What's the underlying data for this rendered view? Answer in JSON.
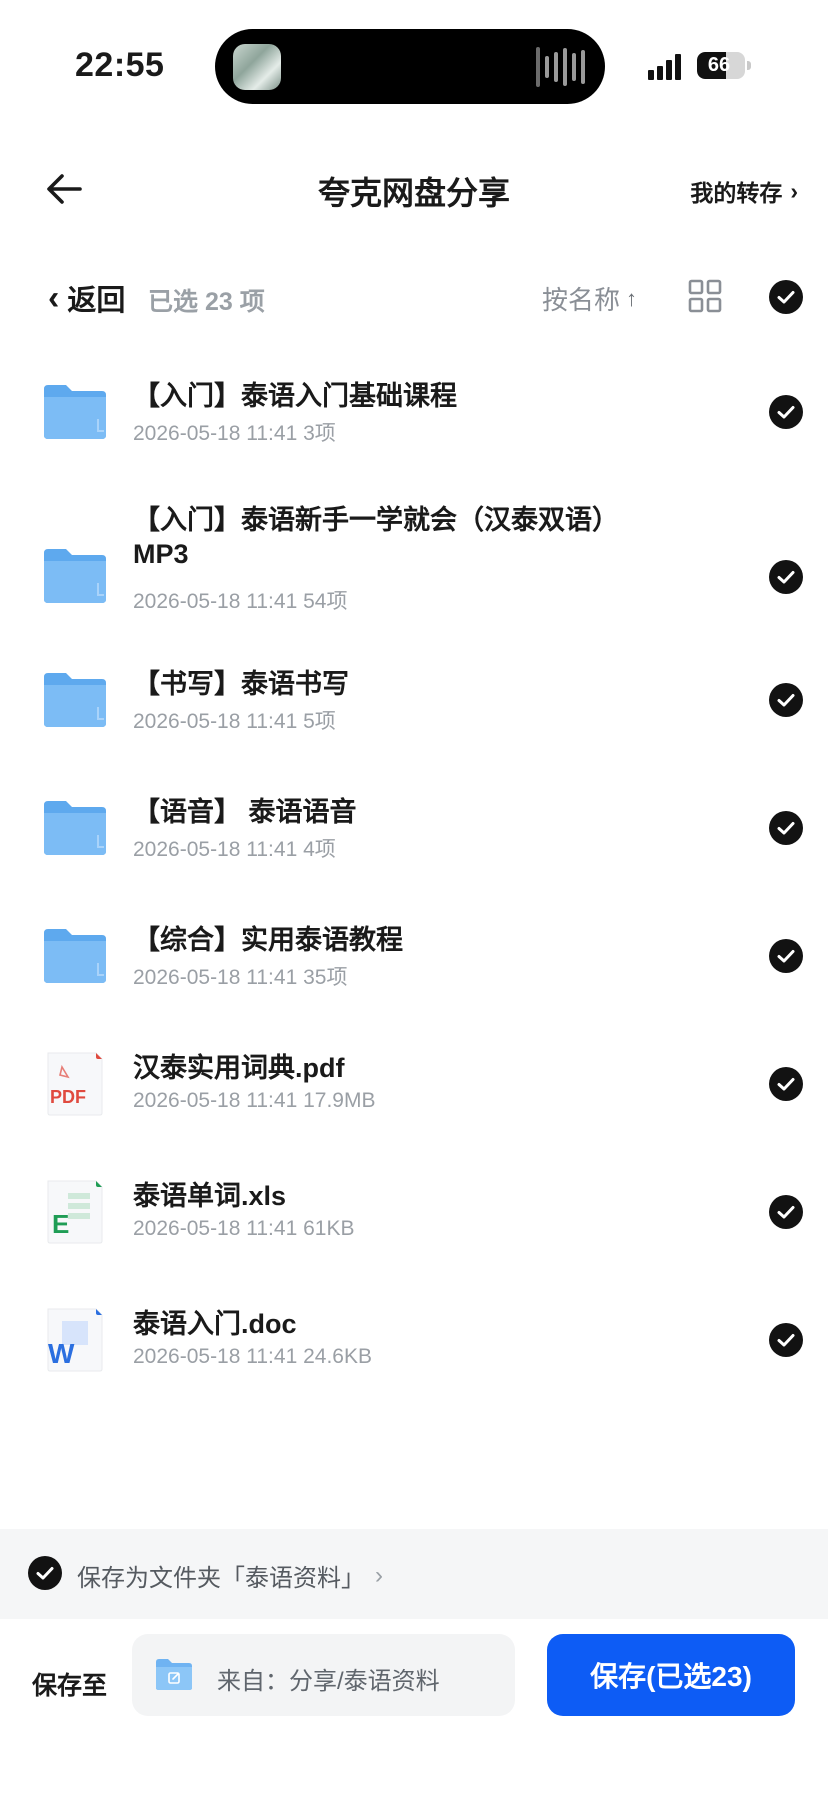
{
  "status_bar": {
    "time": "22:55",
    "battery": "66",
    "battery_level": 0.66
  },
  "nav": {
    "title": "夸克网盘分享",
    "right_link": "我的转存",
    "right_chevron": "›"
  },
  "toolbar": {
    "back_chevron": "‹",
    "back_label": "返回",
    "selected_count": "已选 23 项",
    "sort_label": "按名称",
    "sort_arrow": "↑"
  },
  "files": [
    {
      "type": "folder",
      "name": "【入门】泰语入门基础课程",
      "date": "2026-05-18 11:41",
      "size": "3项"
    },
    {
      "type": "folder",
      "name": "【入门】泰语新手一学就会（汉泰双语）MP3",
      "date": "2026-05-18 11:41",
      "size": "54项"
    },
    {
      "type": "folder",
      "name": "【书写】泰语书写",
      "date": "2026-05-18 11:41",
      "size": "5项"
    },
    {
      "type": "folder",
      "name": "【语音】 泰语语音",
      "date": "2026-05-18 11:41",
      "size": "4项"
    },
    {
      "type": "folder",
      "name": "【综合】实用泰语教程",
      "date": "2026-05-18 11:41",
      "size": "35项"
    },
    {
      "type": "pdf",
      "name": "汉泰实用词典.pdf",
      "date": "2026-05-18 11:41",
      "size": "17.9MB",
      "badge": "PDF"
    },
    {
      "type": "xls",
      "name": "泰语单词.xls",
      "date": "2026-05-18 11:41",
      "size": "61KB",
      "badge": "E"
    },
    {
      "type": "doc",
      "name": "泰语入门.doc",
      "date": "2026-05-18 11:41",
      "size": "24.6KB",
      "badge": "W"
    }
  ],
  "save_as": {
    "text": "保存为文件夹「泰语资料」",
    "chevron": "›"
  },
  "save_bar": {
    "label": "保存至",
    "destination": "来自：分享/泰语资料",
    "button": "保存(已选23)"
  },
  "colors": {
    "accent": "#0d5cf5",
    "folder": "#7cbcf5",
    "pdf": "#e04a3f",
    "xls": "#1f9d55",
    "doc": "#2b6fe0"
  }
}
